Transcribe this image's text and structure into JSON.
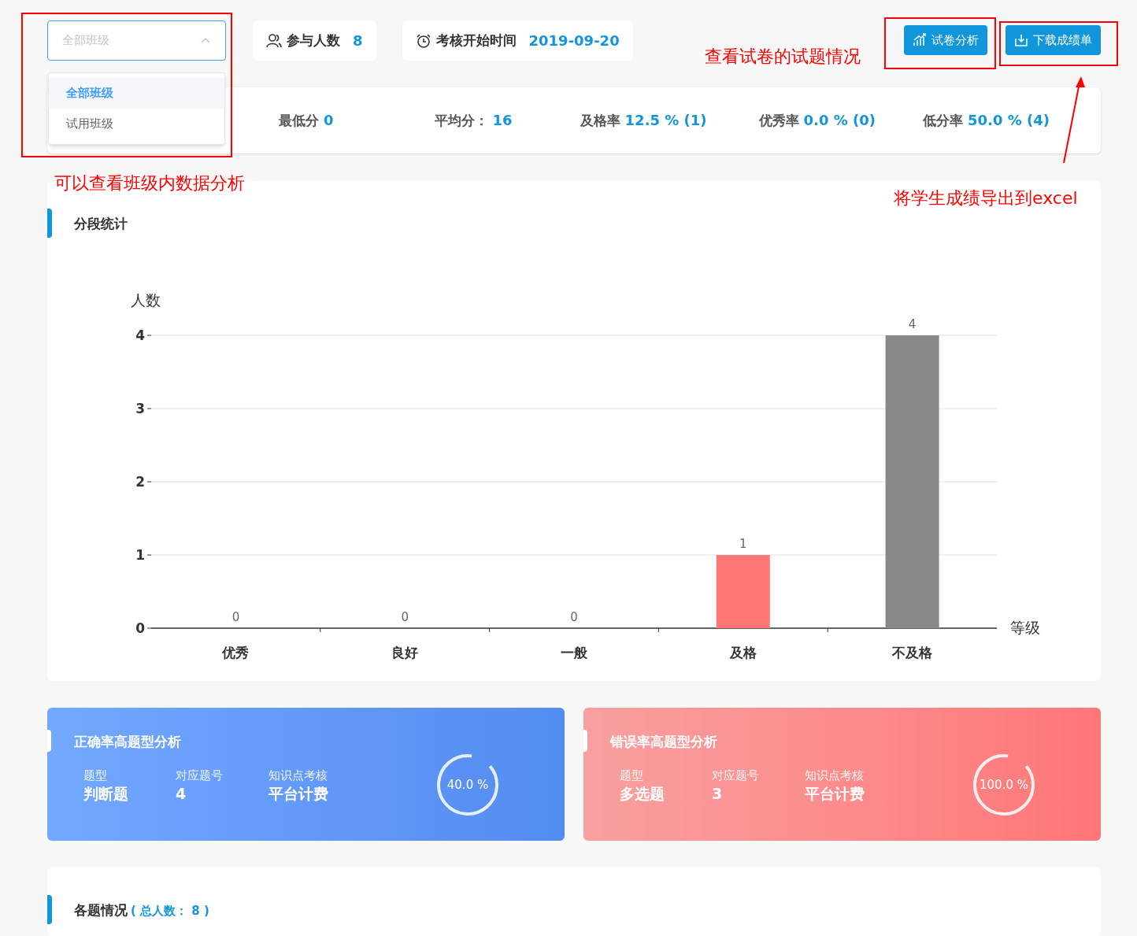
{
  "class_select": {
    "value": "全部班级",
    "expanded": true,
    "options": [
      {
        "label": "全部班级",
        "selected": true
      },
      {
        "label": "试用班级",
        "selected": false
      }
    ]
  },
  "info": [
    {
      "kind": "people",
      "label": "参与人数",
      "value": "8"
    },
    {
      "kind": "clock",
      "label": "考核开始时间",
      "value": "2019-09-20"
    }
  ],
  "buttons": [
    {
      "kind": "chart",
      "label": "试卷分析"
    },
    {
      "kind": "download",
      "label": "下载成绩单"
    }
  ],
  "stats": [
    {
      "label": "最低分",
      "value": "0"
    },
    {
      "label": "平均分：",
      "value": "16"
    },
    {
      "label": "及格率",
      "value": "12.5 % (1)"
    },
    {
      "label": "优秀率",
      "value": "0.0 % (0)"
    },
    {
      "label": "低分率",
      "value": "50.0 % (4)"
    }
  ],
  "score_section": {
    "title": "分段统计",
    "chart_data": {
      "type": "bar",
      "xlabel": "等级",
      "ylabel": "人数",
      "categories": [
        "优秀",
        "良好",
        "一般",
        "及格",
        "不及格"
      ],
      "series": [
        {
          "color": "#888888",
          "values": [
            0,
            0,
            0,
            null,
            4
          ]
        },
        {
          "color": "#ff7875",
          "values": [
            null,
            null,
            null,
            1,
            null
          ]
        }
      ],
      "ylim": [
        0,
        4
      ],
      "yticks": [
        0,
        1,
        2,
        3,
        4
      ],
      "grid": true,
      "data_labels": true
    }
  },
  "analysis_cards": [
    {
      "kind": "correct",
      "title": "正确率高题型分析",
      "fields": [
        {
          "label": "题型",
          "value": "判断题"
        },
        {
          "label": "对应题号",
          "value": "4"
        },
        {
          "label": "知识点考核",
          "value": "平台计费"
        }
      ],
      "rate": "40.0 %"
    },
    {
      "kind": "wrong",
      "title": "错误率高题型分析",
      "fields": [
        {
          "label": "题型",
          "value": "多选题"
        },
        {
          "label": "对应题号",
          "value": "3"
        },
        {
          "label": "知识点考核",
          "value": "平台计费"
        }
      ],
      "rate": "100.0 %"
    }
  ],
  "questions_section": {
    "title": "各题情况",
    "total": "( 总人数： 8 )"
  },
  "annotations": [
    {
      "kind": "class",
      "text": "可以查看班级内数据分析"
    },
    {
      "kind": "analysis",
      "text": "查看试卷的试题情况"
    },
    {
      "kind": "download",
      "text": "将学生成绩导出到excel"
    }
  ]
}
